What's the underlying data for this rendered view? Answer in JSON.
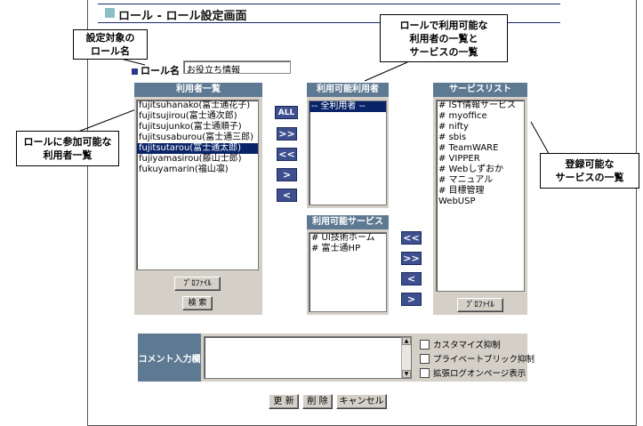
{
  "title": "ロール - ロール設定画面",
  "callouts": {
    "role_name": [
      "設定対象の",
      "ロール名"
    ],
    "users": [
      "ロールに参加可能な",
      "利用者一覧"
    ],
    "available": [
      "ロールで利用可能な",
      "利用者の一覧と",
      "サービスの一覧"
    ],
    "services": [
      "登録可能な",
      "サービスの一覧"
    ]
  },
  "role_name": {
    "label": "ロール名",
    "value": "お役立ち情報"
  },
  "users_panel": {
    "header": "利用者一覧",
    "items": [
      "fujitsuhanako(富士通花子)",
      "fujitsujirou(富士通次郎)",
      "fujitsujunko(富士通順子)",
      "fujitsusaburou(富士通三郎)",
      "fujitsutarou(富士通太郎)",
      "fujiyamasirou(藤山士郎)",
      "fukuyamarin(福山凛)"
    ],
    "selected_index": 4,
    "profile_button": "ﾌﾟﾛﾌｧｲﾙ",
    "search_button": "検 索"
  },
  "user_arrows": {
    "all": "ALL",
    "add": ">>",
    "remove": "<<",
    "next": ">",
    "prev": "<"
  },
  "available_users": {
    "header": "利用可能利用者",
    "items": [
      "-- 全利用者 --"
    ]
  },
  "available_services": {
    "header": "利用可能サービス",
    "items": [
      "# UI技術ホーム",
      "# 富士通HP"
    ]
  },
  "service_arrows": {
    "remove": "<<",
    "add": ">>",
    "prev": "<",
    "next": ">"
  },
  "services_panel": {
    "header": "サービスリスト",
    "items": [
      "# IST情報サービス",
      "# myoffice",
      "# nifty",
      "# sbis",
      "# TeamWARE",
      "# VIPPER",
      "# Webしずおか",
      "# マニュアル",
      "# 目標管理",
      "WebUSP"
    ],
    "profile_button": "ﾌﾟﾛﾌｧｲﾙ"
  },
  "comment": {
    "label": "コメント入力欄",
    "value": ""
  },
  "checkboxes": [
    "カスタマイズ抑制",
    "プライベートブリック抑制",
    "拡張ログオンページ表示"
  ],
  "actions": {
    "update": "更 新",
    "delete": "削 除",
    "cancel": "キャンセル"
  },
  "colors": {
    "panel_header": "#5e7a93",
    "arrow_button": "#3e4f8f",
    "selection": "#0a246a",
    "panel_bg": "#d4d0c8"
  }
}
